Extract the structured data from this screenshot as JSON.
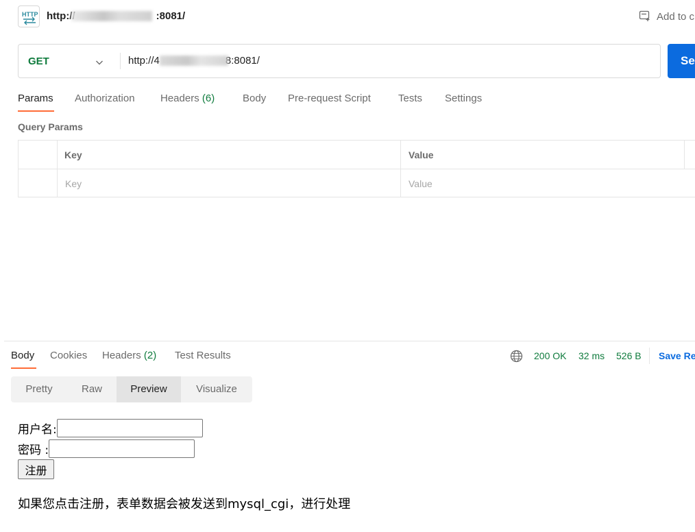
{
  "titlebar": {
    "url_prefix": "http://",
    "url_suffix": ":8081/",
    "add_to": "Add to c"
  },
  "request": {
    "method": "GET",
    "url_prefix": "http://4",
    "url_suffix": "8:8081/",
    "send": "Se"
  },
  "request_tabs": [
    {
      "label": "Params",
      "active": true
    },
    {
      "label": "Authorization"
    },
    {
      "label": "Headers",
      "count": "(6)"
    },
    {
      "label": "Body"
    },
    {
      "label": "Pre-request Script"
    },
    {
      "label": "Tests"
    },
    {
      "label": "Settings"
    }
  ],
  "query_params": {
    "title": "Query Params",
    "headers": [
      "Key",
      "Value"
    ],
    "placeholders": [
      "Key",
      "Value"
    ]
  },
  "response_tabs": [
    {
      "label": "Body",
      "active": true
    },
    {
      "label": "Cookies"
    },
    {
      "label": "Headers",
      "count": "(2)"
    },
    {
      "label": "Test Results"
    }
  ],
  "response_status": {
    "status": "200 OK",
    "time": "32 ms",
    "size": "526 B",
    "save": "Save Re"
  },
  "view_modes": [
    {
      "label": "Pretty"
    },
    {
      "label": "Raw"
    },
    {
      "label": "Preview",
      "active": true
    },
    {
      "label": "Visualize"
    }
  ],
  "preview": {
    "username_label": "用户名:",
    "password_label": "密码 :",
    "register_button": "注册",
    "note": "如果您点击注册，表单数据会被发送到mysql_cgi，进行处理"
  },
  "colors": {
    "accent_orange": "#ff6c37",
    "status_green": "#0f7b3d",
    "send_blue": "#0b6bdf"
  },
  "icons": [
    "http-icon",
    "add-to-collection-icon",
    "chevron-down-icon",
    "globe-icon"
  ]
}
